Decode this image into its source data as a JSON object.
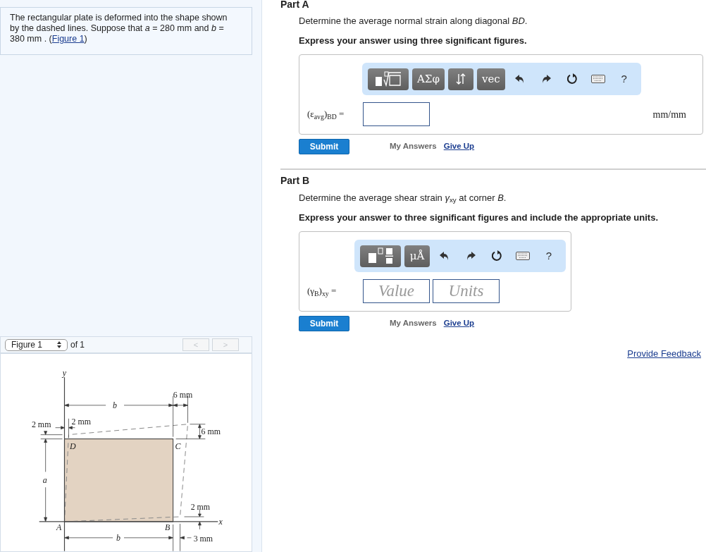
{
  "problem": {
    "text_before": "The rectangular plate is deformed into the shape shown by the dashed lines. Suppose that *a* = 280 mm and *b* = 380 mm . (",
    "link": "Figure 1",
    "text_after": ")"
  },
  "figure_nav": {
    "select": "Figure 1",
    "of": "of 1",
    "prev": {
      "label": "<",
      "disabled": true
    },
    "next": {
      "label": ">",
      "disabled": true
    }
  },
  "figure": {
    "labels": [
      {
        "text": "y",
        "kind": "variable"
      },
      {
        "text": "b",
        "kind": "variable"
      },
      {
        "text": "6 mm",
        "kind": "dimension"
      },
      {
        "text": "2 mm",
        "kind": "dimension"
      },
      {
        "text": "2 mm",
        "kind": "dimension"
      },
      {
        "text": "6 mm",
        "kind": "dimension"
      },
      {
        "text": "D",
        "kind": "variable"
      },
      {
        "text": "C",
        "kind": "variable"
      },
      {
        "text": "a",
        "kind": "variable"
      },
      {
        "text": "2 mm",
        "kind": "dimension"
      },
      {
        "text": "A",
        "kind": "variable"
      },
      {
        "text": "B",
        "kind": "variable"
      },
      {
        "text": "x",
        "kind": "variable"
      },
      {
        "text": "b",
        "kind": "variable"
      },
      {
        "text": "3 mm",
        "kind": "dimension"
      }
    ]
  },
  "parts": [
    {
      "title": "Part A",
      "question": "Determine the average normal strain along diagonal *BD*.",
      "instruction": "Express your answer using three significant figures.",
      "toolbar": [
        {
          "kind": "template"
        },
        {
          "kind": "text",
          "label": "ΑΣφ"
        },
        {
          "kind": "arrows"
        },
        {
          "kind": "text",
          "label": "vec"
        },
        {
          "kind": "undo"
        },
        {
          "kind": "redo"
        },
        {
          "kind": "reset"
        },
        {
          "kind": "keyboard"
        },
        {
          "kind": "help",
          "label": "?"
        }
      ],
      "answer_label": "(ε$_{avg}$)$_{BD}$ =",
      "blank_field": true,
      "unit": "mm/mm",
      "submit": "Submit",
      "my_answers": "My Answers",
      "give_up": "Give Up"
    },
    {
      "title": "Part B",
      "question": "Determine the average shear strain *γ*$_{xy}$ at corner *B*.",
      "instruction": "Express your answer to three significant figures and include the appropriate units.",
      "toolbar": [
        {
          "kind": "fraction"
        },
        {
          "kind": "text",
          "label": "μÅ"
        },
        {
          "kind": "undo"
        },
        {
          "kind": "redo"
        },
        {
          "kind": "reset"
        },
        {
          "kind": "keyboard"
        },
        {
          "kind": "help",
          "label": "?"
        }
      ],
      "answer_label": "(γ$_{B}$)$_{xy}$ =",
      "fields": [
        {
          "placeholder": "Value"
        },
        {
          "placeholder": "Units"
        }
      ],
      "submit": "Submit",
      "my_answers": "My Answers",
      "give_up": "Give Up"
    }
  ],
  "feedback_link": "Provide Feedback"
}
